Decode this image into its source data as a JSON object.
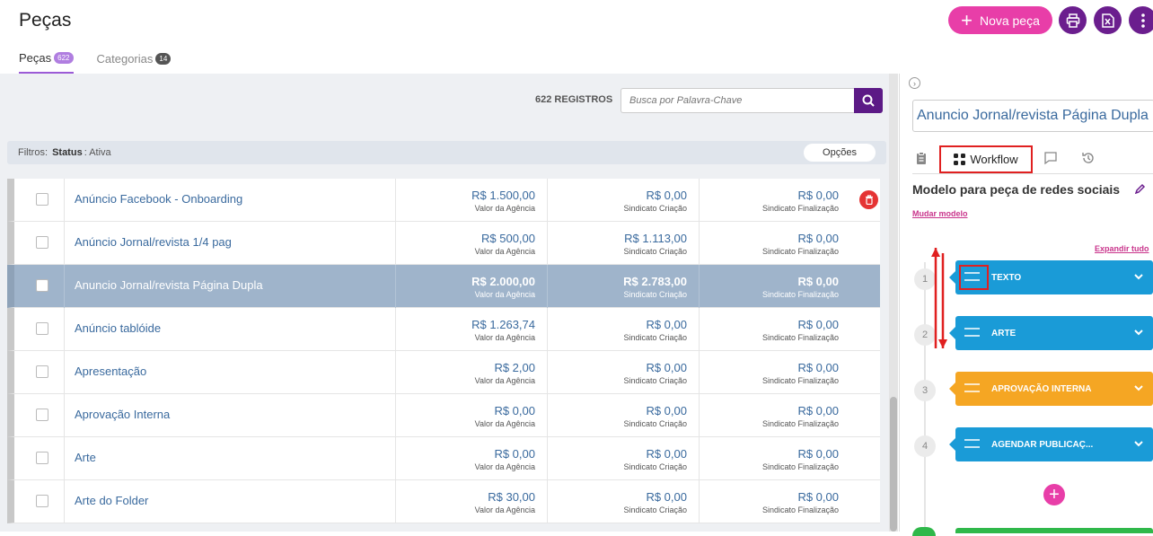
{
  "page": {
    "title": "Peças"
  },
  "header": {
    "new_button_label": "Nova peça",
    "tabs": [
      {
        "label": "Peças",
        "count": "622",
        "active": true
      },
      {
        "label": "Categorias",
        "count": "14",
        "active": false
      }
    ]
  },
  "list": {
    "records_label": "622 REGISTROS",
    "search_placeholder": "Busca por Palavra-Chave",
    "filter": {
      "prefix": "Filtros:",
      "key": "Status",
      "value": ": Ativa"
    },
    "options_label": "Opções",
    "rows": [
      {
        "name": "Anúncio Facebook - Onboarding",
        "agency": "R$ 1.500,00",
        "criacao": "R$ 0,00",
        "finalizacao": "R$ 0,00",
        "selected": false,
        "trash": true
      },
      {
        "name": "Anúncio Jornal/revista 1/4 pag",
        "agency": "R$ 500,00",
        "criacao": "R$ 1.113,00",
        "finalizacao": "R$ 0,00",
        "selected": false,
        "trash": false
      },
      {
        "name": "Anuncio Jornal/revista Página Dupla",
        "agency": "R$ 2.000,00",
        "criacao": "R$ 2.783,00",
        "finalizacao": "R$ 0,00",
        "selected": true,
        "trash": false
      },
      {
        "name": "Anúncio tablóide",
        "agency": "R$ 1.263,74",
        "criacao": "R$ 0,00",
        "finalizacao": "R$ 0,00",
        "selected": false,
        "trash": false
      },
      {
        "name": "Apresentação",
        "agency": "R$ 2,00",
        "criacao": "R$ 0,00",
        "finalizacao": "R$ 0,00",
        "selected": false,
        "trash": false
      },
      {
        "name": "Aprovação Interna",
        "agency": "R$ 0,00",
        "criacao": "R$ 0,00",
        "finalizacao": "R$ 0,00",
        "selected": false,
        "trash": false
      },
      {
        "name": "Arte",
        "agency": "R$ 0,00",
        "criacao": "R$ 0,00",
        "finalizacao": "R$ 0,00",
        "selected": false,
        "trash": false
      },
      {
        "name": "Arte do Folder",
        "agency": "R$ 30,00",
        "criacao": "R$ 0,00",
        "finalizacao": "R$ 0,00",
        "selected": false,
        "trash": false
      }
    ],
    "value_labels": {
      "agency": "Valor da Agência",
      "criacao": "Sindicato Criação",
      "finalizacao": "Sindicato Finalização"
    }
  },
  "panel": {
    "piece_title": "Anuncio Jornal/revista Página Dupla",
    "workflow_tab_label": "Workflow",
    "model_title": "Modelo para peça de redes sociais",
    "change_model_link": "Mudar modelo",
    "expand_all_link": "Expandir tudo",
    "steps": [
      {
        "number": "1",
        "label": "TEXTO",
        "color": "#1a9bd7"
      },
      {
        "number": "2",
        "label": "ARTE",
        "color": "#1a9bd7"
      },
      {
        "number": "3",
        "label": "APROVAÇÃO INTERNA",
        "color": "#f5a623"
      },
      {
        "number": "4",
        "label": "AGENDAR PUBLICAÇ...",
        "color": "#1a9bd7"
      }
    ]
  },
  "colors": {
    "accent": "#e83ea8",
    "brand": "#6b1e8e",
    "selected_row": "#9fb4cb",
    "link": "#3a6a9e"
  }
}
